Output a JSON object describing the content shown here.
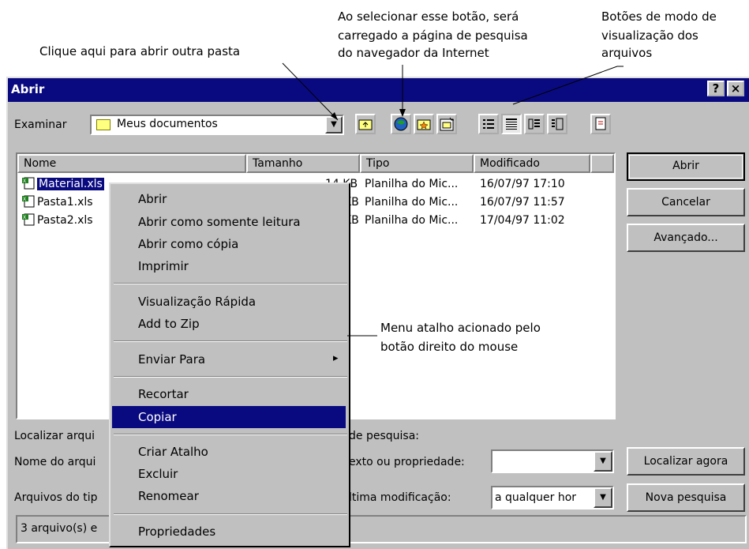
{
  "annotations": {
    "open_folder": "Clique aqui para abrir outra pasta",
    "search_button": [
      "Ao selecionar esse botão, será",
      "carregado a página de pesquisa",
      "do navegador da Internet"
    ],
    "view_modes": [
      "Botões de modo de",
      "visualização dos",
      "arquivos"
    ],
    "context_menu": [
      "Menu atalho acionado pelo",
      "botão direito do mouse"
    ]
  },
  "dialog": {
    "title": "Abrir",
    "help_label": "?",
    "close_label": "×",
    "look_in_label": "Examinar",
    "look_in_value": "Meus documentos",
    "columns": [
      "Nome",
      "Tamanho",
      "Tipo",
      "Modificado"
    ],
    "files": [
      {
        "name": "Material.xls",
        "size": "14 KB",
        "type": "Planilha do Mic...",
        "modified": "16/07/97 17:10"
      },
      {
        "name": "Pasta1.xls",
        "size": "KB",
        "type": "Planilha do Mic...",
        "modified": "16/07/97 11:57"
      },
      {
        "name": "Pasta2.xls",
        "size": "KB",
        "type": "Planilha do Mic...",
        "modified": "17/04/97 11:02"
      }
    ],
    "buttons": {
      "open": "Abrir",
      "cancel": "Cancelar",
      "advanced": "Avançado...",
      "find_now": "Localizar agora",
      "new_search": "Nova pesquisa"
    },
    "search": {
      "find_label_left": "Localizar arqui",
      "find_label_right": "de pesquisa:",
      "filename_left": "Nome do arqui",
      "text_prop_label": "exto ou propriedade:",
      "text_prop_value": "",
      "filetype_left": "Arquivos do tip",
      "modified_label": "ltima modificação:",
      "modified_value": "a qualquer hor"
    },
    "status_left": "3 arquivo(s) e"
  },
  "context_menu": {
    "items": [
      "Abrir",
      "Abrir como somente leitura",
      "Abrir como cópia",
      "Imprimir",
      "Visualização Rápida",
      "Add to Zip",
      "Enviar Para",
      "Recortar",
      "Copiar",
      "Criar Atalho",
      "Excluir",
      "Renomear",
      "Propriedades"
    ],
    "highlighted": "Copiar",
    "submenu_arrow": "▸"
  },
  "colors": {
    "title_bar": "#0a0a80",
    "face": "#c0c0c0",
    "selection": "#0a0a80"
  }
}
